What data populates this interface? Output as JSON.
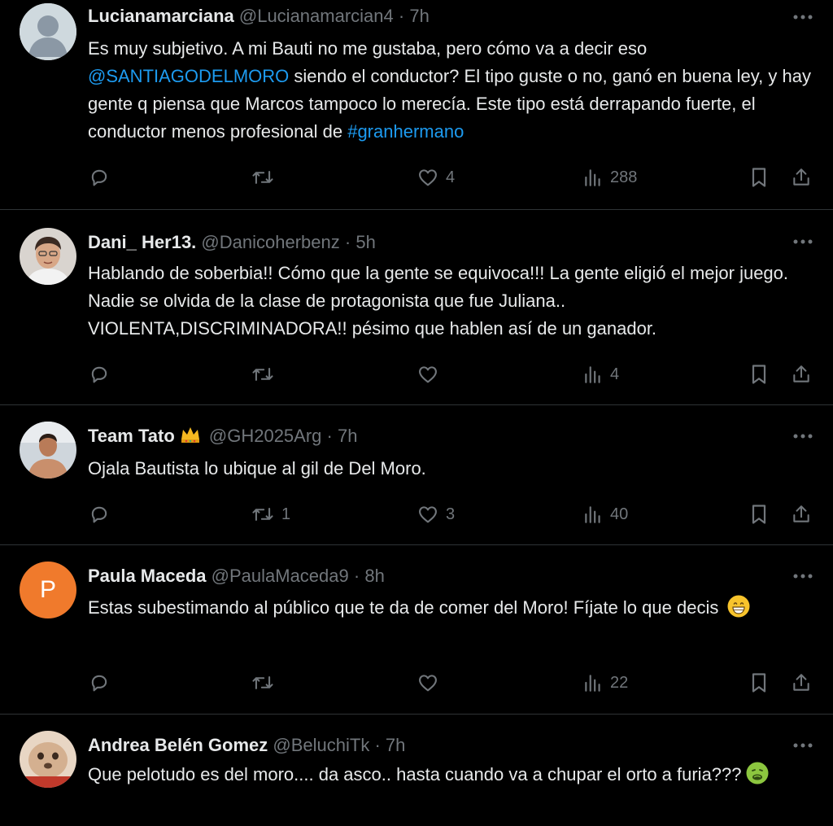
{
  "colors": {
    "background": "#000000",
    "text": "#e7e9ea",
    "muted": "#71767b",
    "link": "#1d9bf0",
    "divider": "#2f3336"
  },
  "tweets": [
    {
      "name": "Lucianamarciana",
      "handle": "@Lucianamarcian4",
      "sep": "·",
      "time": "7h",
      "avatar": "default-avatar-icon",
      "text_1": "Es muy subjetivo. A mi Bauti no me gustaba, pero cómo va a decir eso ",
      "mention": "@SANTIAGODELMORO",
      "text_2": " siendo el conductor? El tipo guste o no, ganó en buena ley, y hay gente q piensa que Marcos tampoco lo merecía. Este tipo está derrapando fuerte, el conductor menos profesional de ",
      "hashtag": "#granhermano",
      "reply_count": "",
      "retweet_count": "",
      "like_count": "4",
      "view_count": "288"
    },
    {
      "name": "Dani_ Her13.",
      "handle": "@Danicoherbenz",
      "sep": "·",
      "time": "5h",
      "avatar": "photo-avatar-icon",
      "text": "Hablando de soberbia!! Cómo que la gente se equivoca!!! La gente eligió el mejor juego. Nadie se olvida de la clase de protagonista que fue Juliana.. VIOLENTA,DISCRIMINADORA!! pésimo que hablen así de un ganador.",
      "reply_count": "",
      "retweet_count": "",
      "like_count": "",
      "view_count": "4"
    },
    {
      "name": "Team Tato",
      "handle": "@GH2025Arg",
      "sep": "·",
      "time": "7h",
      "avatar": "photo-avatar-icon",
      "badge": "crown-emoji",
      "text": "Ojala Bautista lo ubique al gil de Del Moro.",
      "reply_count": "",
      "retweet_count": "1",
      "like_count": "3",
      "view_count": "40"
    },
    {
      "name": "Paula Maceda",
      "handle": "@PaulaMaceda9",
      "sep": "·",
      "time": "8h",
      "avatar": "initial-avatar",
      "avatar_letter": "P",
      "avatar_color": "#f07a2c",
      "text": "Estas subestimando al público que te da de comer del Moro! Fíjate lo que decis",
      "emoji": "grinning-face-emoji",
      "reply_count": "",
      "retweet_count": "",
      "like_count": "",
      "view_count": "22"
    },
    {
      "name": "Andrea Belén Gomez",
      "handle": "@BeluchiTk",
      "sep": "·",
      "time": "7h",
      "avatar": "photo-avatar-icon",
      "text": "Que pelotudo es del moro.... da asco.. hasta cuando va a chupar el orto a furia???",
      "emoji": "nauseated-face-emoji"
    }
  ]
}
